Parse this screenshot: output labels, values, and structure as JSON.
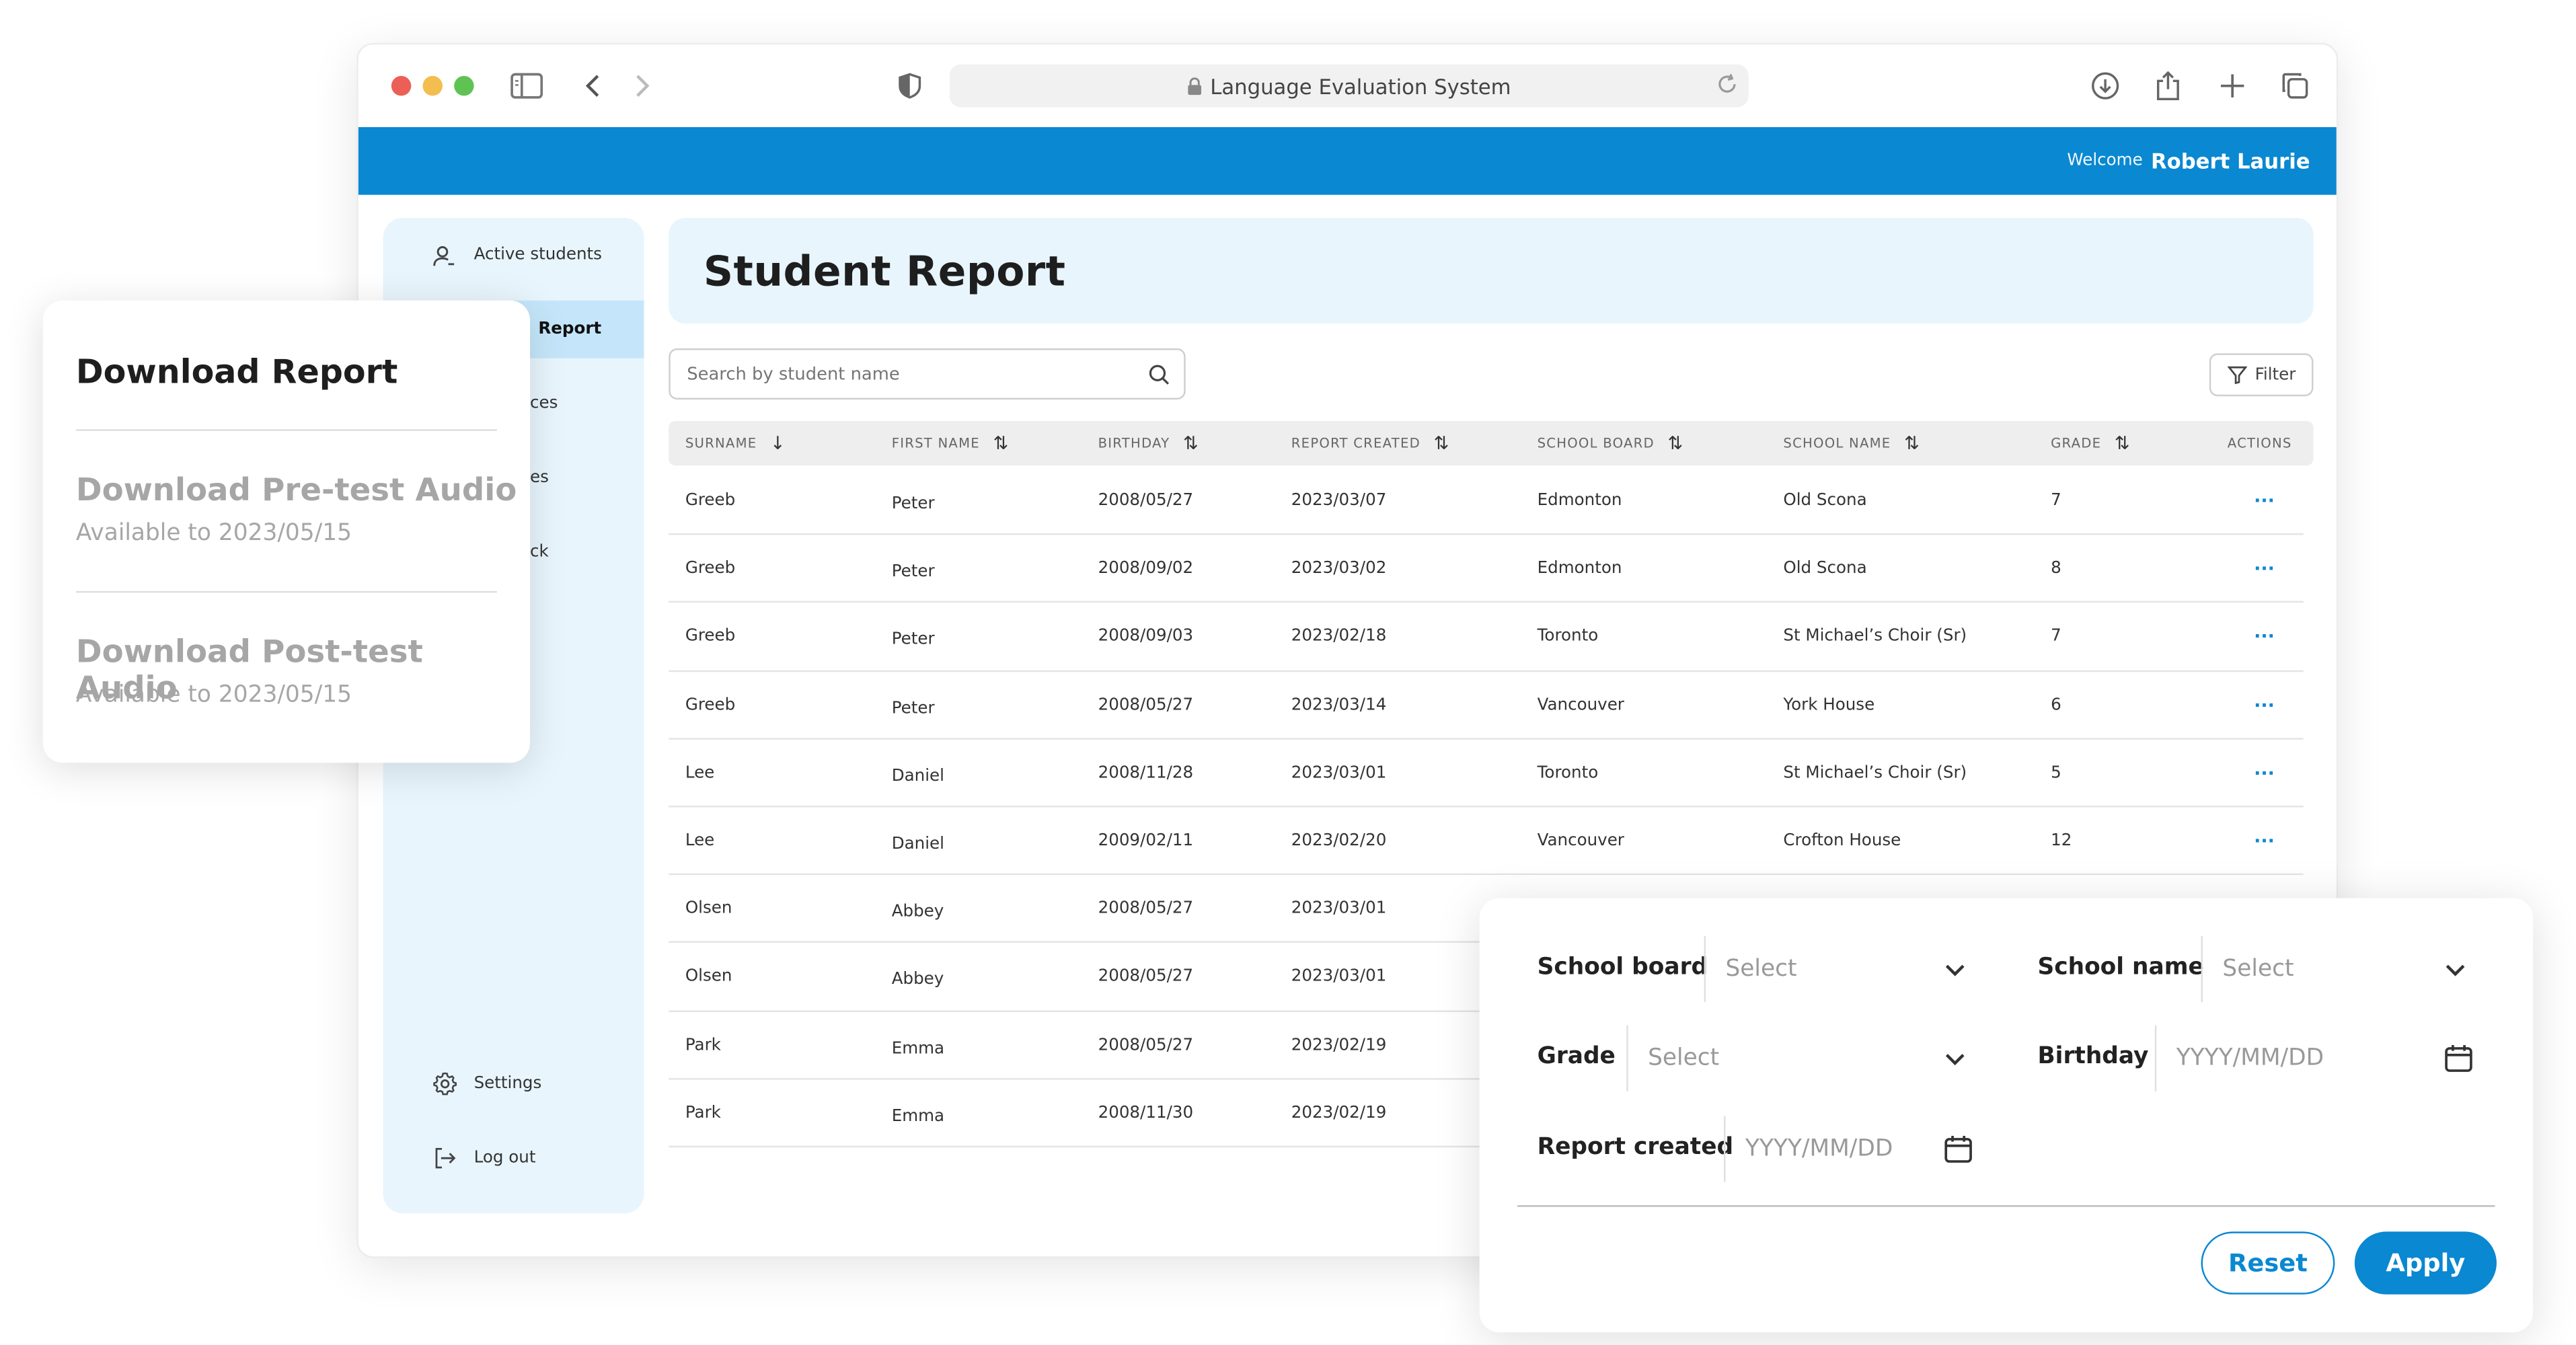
{
  "browser": {
    "url_text": "Language Evaluation System"
  },
  "header": {
    "welcome_label": "Welcome",
    "username": "Robert Laurie",
    "bar_color": "#0a88d1"
  },
  "sidebar": {
    "items": [
      {
        "label": "Active students",
        "icon": "user-icon"
      },
      {
        "label": "Report",
        "icon": "report-icon",
        "active": true
      },
      {
        "label": "ces",
        "icon": ""
      },
      {
        "label": "es",
        "icon": ""
      },
      {
        "label": "ck",
        "icon": ""
      }
    ],
    "bottom": [
      {
        "label": "Settings",
        "icon": "gear-icon"
      },
      {
        "label": "Log out",
        "icon": "logout-icon"
      }
    ]
  },
  "main": {
    "title": "Student Report",
    "search_placeholder": "Search by student name",
    "filter_label": "Filter"
  },
  "table": {
    "columns": [
      {
        "label": "SURNAME",
        "sort": "↓"
      },
      {
        "label": "FIRST NAME",
        "sort": "⇅"
      },
      {
        "label": "BIRTHDAY",
        "sort": "⇅"
      },
      {
        "label": "REPORT CREATED",
        "sort": "⇅"
      },
      {
        "label": "SCHOOL BOARD",
        "sort": "⇅"
      },
      {
        "label": "SCHOOL NAME",
        "sort": "⇅"
      },
      {
        "label": "GRADE",
        "sort": "⇅"
      },
      {
        "label": "ACTIONS",
        "sort": ""
      }
    ],
    "rows": [
      [
        "Greeb",
        "Peter",
        "2008/05/27",
        "2023/03/07",
        "Edmonton",
        "Old Scona",
        "7",
        "···"
      ],
      [
        "Greeb",
        "Peter",
        "2008/09/02",
        "2023/03/02",
        "Edmonton",
        "Old Scona",
        "8",
        "···"
      ],
      [
        "Greeb",
        "Peter",
        "2008/09/03",
        "2023/02/18",
        "Toronto",
        "St Michael’s Choir (Sr)",
        "7",
        "···"
      ],
      [
        "Greeb",
        "Peter",
        "2008/05/27",
        "2023/03/14",
        "Vancouver",
        "York House",
        "6",
        "···"
      ],
      [
        "Lee",
        "Daniel",
        "2008/11/28",
        "2023/03/01",
        "Toronto",
        "St Michael’s Choir (Sr)",
        "5",
        "···"
      ],
      [
        "Lee",
        "Daniel",
        "2009/02/11",
        "2023/02/20",
        "Vancouver",
        "Crofton House",
        "12",
        "···"
      ],
      [
        "Olsen",
        "Abbey",
        "2008/05/27",
        "2023/03/01",
        "",
        "",
        "",
        ""
      ],
      [
        "Olsen",
        "Abbey",
        "2008/05/27",
        "2023/03/01",
        "",
        "",
        "",
        ""
      ],
      [
        "Park",
        "Emma",
        "2008/05/27",
        "2023/02/19",
        "",
        "",
        "",
        ""
      ],
      [
        "Park",
        "Emma",
        "2008/11/30",
        "2023/02/19",
        "",
        "",
        "",
        ""
      ]
    ]
  },
  "download_card": {
    "title": "Download Report",
    "options": [
      {
        "title": "Download Pre-test Audio",
        "subtitle": "Available to 2023/05/15"
      },
      {
        "title": "Download Post-test Audio",
        "subtitle": "Available to 2023/05/15"
      }
    ]
  },
  "filter_panel": {
    "school_board_label": "School board",
    "school_board_value": "Select",
    "school_name_label": "School name",
    "school_name_value": "Select",
    "grade_label": "Grade",
    "grade_value": "Select",
    "birthday_label": "Birthday",
    "birthday_placeholder": "YYYY/MM/DD",
    "report_created_label": "Report created",
    "report_created_placeholder": "YYYY/MM/DD",
    "reset_label": "Reset",
    "apply_label": "Apply"
  }
}
